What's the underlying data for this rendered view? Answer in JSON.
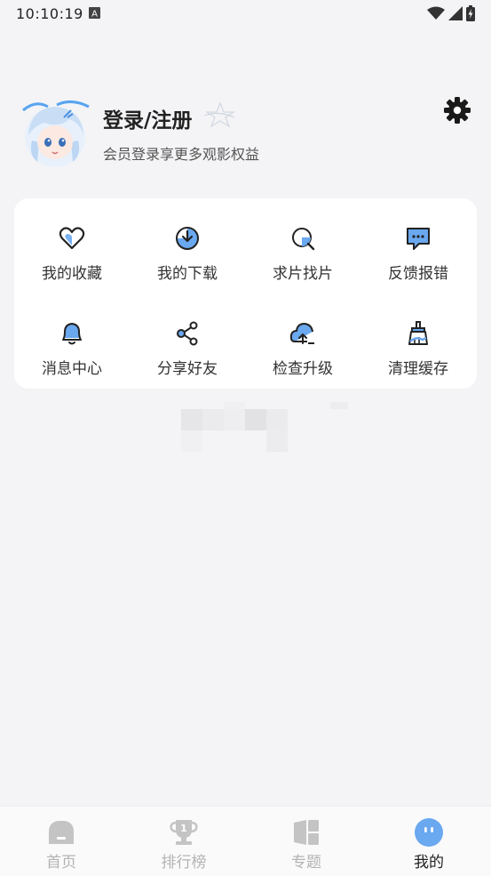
{
  "status": {
    "time": "10:10:19"
  },
  "profile": {
    "title": "登录/注册",
    "subtitle": "会员登录享更多观影权益"
  },
  "menu": [
    {
      "label": "我的收藏",
      "icon": "heart-icon"
    },
    {
      "label": "我的下载",
      "icon": "download-icon"
    },
    {
      "label": "求片找片",
      "icon": "search-film-icon"
    },
    {
      "label": "反馈报错",
      "icon": "feedback-icon"
    },
    {
      "label": "消息中心",
      "icon": "bell-icon"
    },
    {
      "label": "分享好友",
      "icon": "share-icon"
    },
    {
      "label": "检查升级",
      "icon": "upgrade-icon"
    },
    {
      "label": "清理缓存",
      "icon": "clean-icon"
    }
  ],
  "tabs": [
    {
      "label": "首页",
      "icon": "home-icon"
    },
    {
      "label": "排行榜",
      "icon": "trophy-icon"
    },
    {
      "label": "专题",
      "icon": "topic-icon"
    },
    {
      "label": "我的",
      "icon": "profile-icon"
    }
  ],
  "colors": {
    "accent": "#6aa8ef",
    "inactive": "#c4c4c4"
  }
}
